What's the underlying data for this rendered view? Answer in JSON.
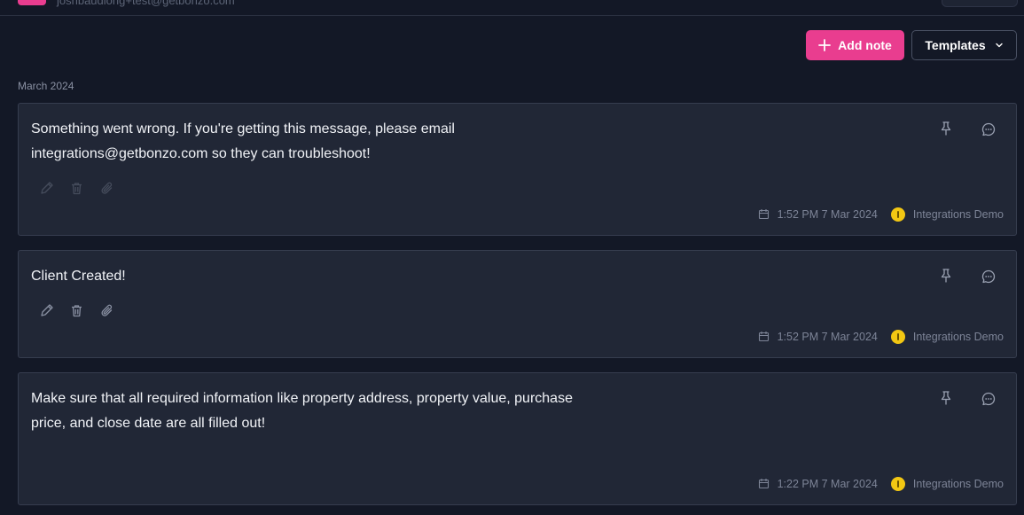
{
  "header": {
    "email": "joshbaudiong+test@getbonzo.com"
  },
  "toolbar": {
    "add_note_label": "Add note",
    "templates_label": "Templates"
  },
  "month_label": "March 2024",
  "notes": [
    {
      "text": "Something went wrong. If you're getting this message, please email integrations@getbonzo.com so they can troubleshoot!",
      "time": "1:52 PM 7 Mar 2024",
      "author": "Integrations Demo",
      "actions_enabled": false
    },
    {
      "text": "Client Created!",
      "time": "1:52 PM 7 Mar 2024",
      "author": "Integrations Demo",
      "actions_enabled": true
    },
    {
      "text": "Make sure that all required information like property address, property value, purchase price, and close date are all filled out!",
      "time": "1:22 PM 7 Mar 2024",
      "author": "Integrations Demo"
    }
  ],
  "colors": {
    "background": "#131826",
    "card": "#212736",
    "accent": "#e93d8f",
    "author_dot": "#f2c713"
  },
  "icons": [
    "plus-icon",
    "chevron-down-icon",
    "pin-icon",
    "comment-icon",
    "pencil-icon",
    "trash-icon",
    "paperclip-icon",
    "calendar-icon"
  ]
}
